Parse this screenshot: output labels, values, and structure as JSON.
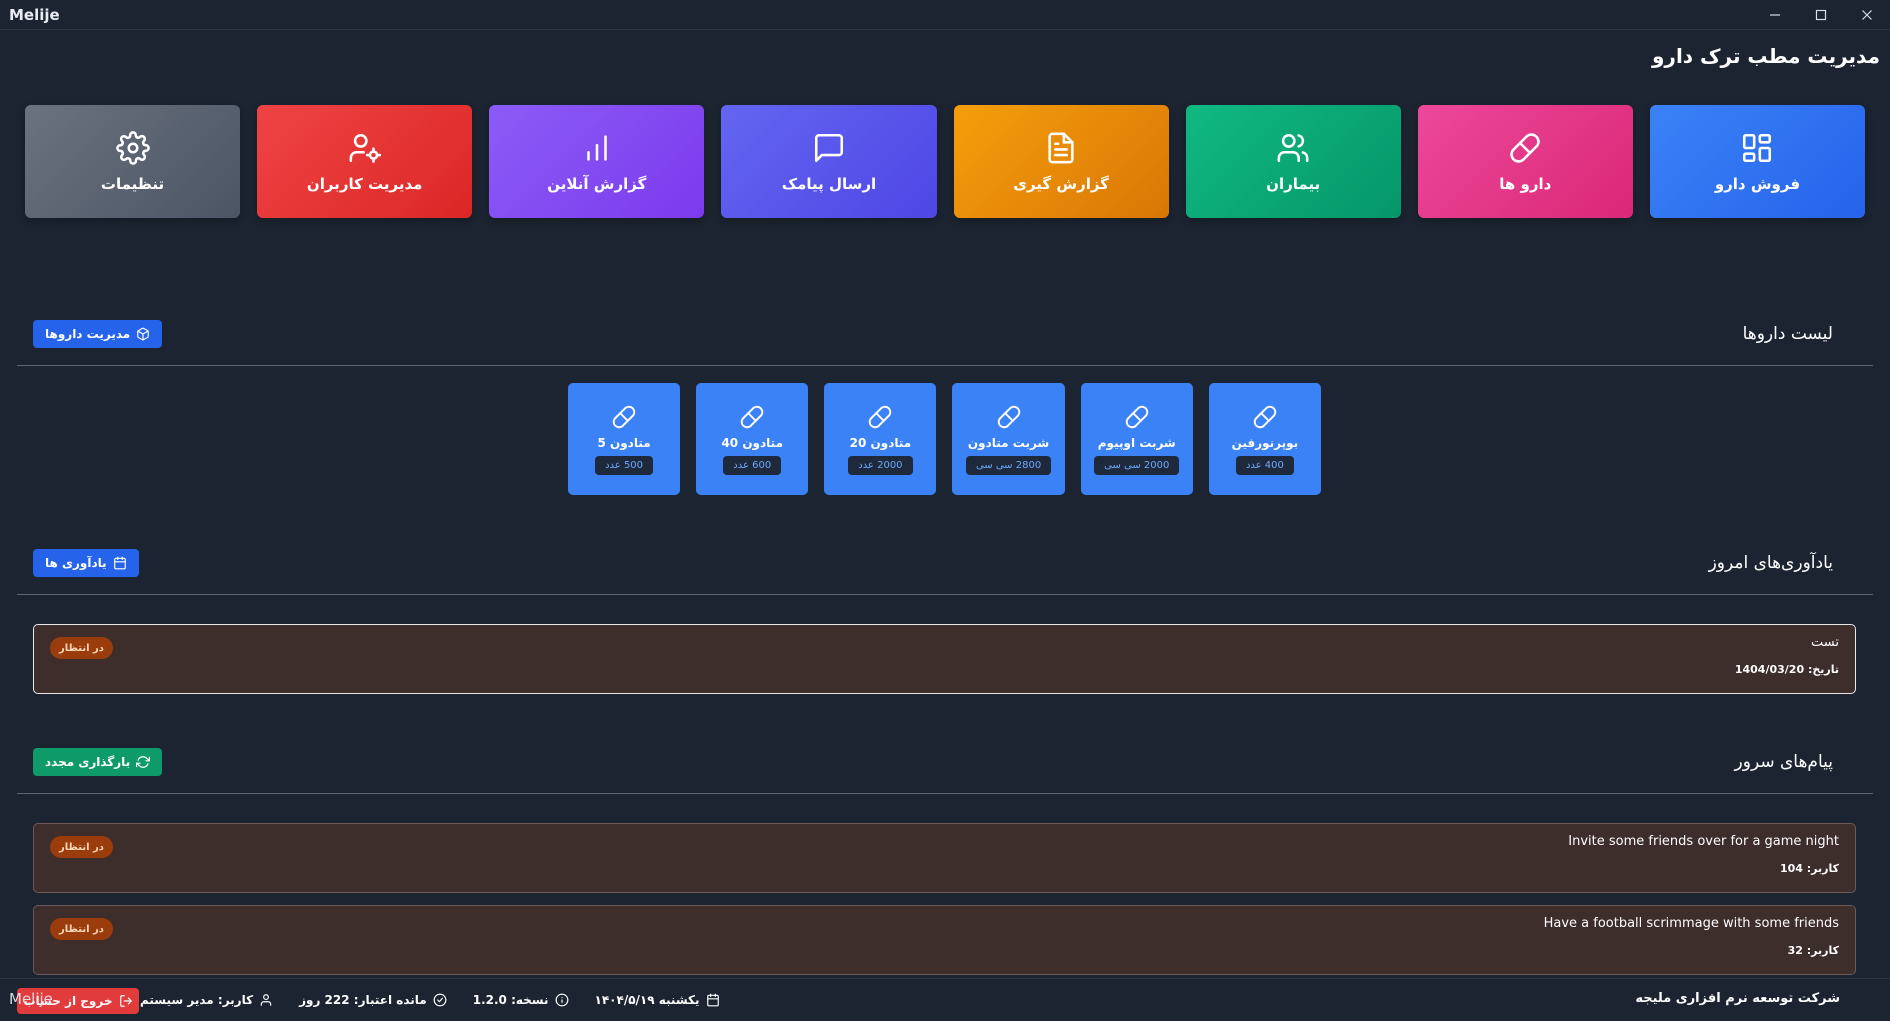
{
  "window": {
    "title": "Melije"
  },
  "header": {
    "title": "مدیریت مطب ترک دارو"
  },
  "tiles": [
    {
      "label": "فروش دارو",
      "icon": "grid-icon",
      "color": "#3b82f6"
    },
    {
      "label": "دارو ها",
      "icon": "pill-icon",
      "color": "#ec4899"
    },
    {
      "label": "بیماران",
      "icon": "users-icon",
      "color": "#10b981"
    },
    {
      "label": "گزارش گیری",
      "icon": "document-icon",
      "color": "#f59e0b"
    },
    {
      "label": "ارسال پیامک",
      "icon": "message-icon",
      "color": "#5b5ce0"
    },
    {
      "label": "گزارش آنلاین",
      "icon": "bar-chart-icon",
      "color": "#8b5cf6"
    },
    {
      "label": "مدیریت کاربران",
      "icon": "user-settings-icon",
      "color": "#ef4444"
    },
    {
      "label": "تنظیمات",
      "icon": "gear-icon",
      "color": "#6b7280"
    }
  ],
  "drugs_section": {
    "title": "لیست داروها",
    "button_label": "مدیریت داروها",
    "items": [
      {
        "name": "بوپرنورفین",
        "qty": "400 عدد"
      },
      {
        "name": "شربت اوپیوم",
        "qty": "2000 سی سی"
      },
      {
        "name": "شربت متادون",
        "qty": "2800 سی سی"
      },
      {
        "name": "متادون 20",
        "qty": "2000 عدد"
      },
      {
        "name": "متادون 40",
        "qty": "600 عدد"
      },
      {
        "name": "متادون 5",
        "qty": "500 عدد"
      }
    ]
  },
  "reminders_section": {
    "title": "یادآوری‌های امروز",
    "button_label": "یادآوری ها",
    "items": [
      {
        "title": "تست",
        "date": "تاریخ: 1404/03/20",
        "status": "در انتظار"
      }
    ]
  },
  "messages_section": {
    "title": "پیام‌های سرور",
    "button_label": "بارگذاری مجدد",
    "items": [
      {
        "text": "Invite some friends over for a game night",
        "user": "کاربر: 104",
        "status": "در انتظار"
      },
      {
        "text": "Have a football scrimmage with some friends",
        "user": "کاربر: 32",
        "status": "در انتظار"
      }
    ]
  },
  "footer": {
    "company": "شرکت توسعه نرم افزاری ملیجه",
    "date": "یکشنبه ۱۴۰۴/۵/۱۹",
    "version": "نسخه: 1.2.0",
    "validity": "مانده اعتبار: 222 روز",
    "user": "کاربر: مدیر سیستم",
    "logout_label": "خروج از حساب",
    "app_name": "Melije"
  }
}
